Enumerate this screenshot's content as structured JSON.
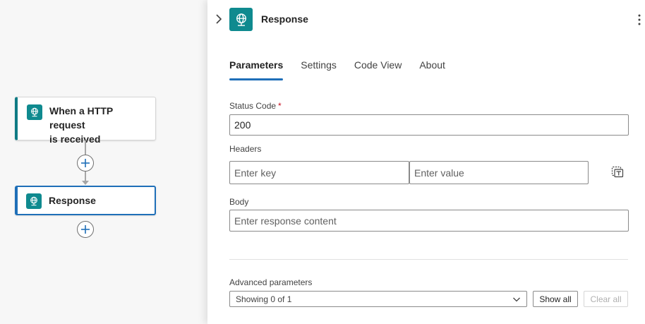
{
  "flow": {
    "trigger": {
      "label_line1": "When a HTTP request",
      "label_line2": "is received",
      "icon": "globe-network-icon"
    },
    "action": {
      "label": "Response",
      "icon": "globe-network-icon"
    }
  },
  "panel": {
    "title": "Response",
    "tabs": [
      {
        "label": "Parameters",
        "active": true
      },
      {
        "label": "Settings",
        "active": false
      },
      {
        "label": "Code View",
        "active": false
      },
      {
        "label": "About",
        "active": false
      }
    ],
    "status_code": {
      "label": "Status Code",
      "required_mark": "*",
      "value": "200"
    },
    "headers": {
      "label": "Headers",
      "key_placeholder": "Enter key",
      "value_placeholder": "Enter value"
    },
    "body": {
      "label": "Body",
      "placeholder": "Enter response content"
    },
    "advanced": {
      "label": "Advanced parameters",
      "selected": "Showing 0 of 1",
      "show_all": "Show all",
      "clear_all": "Clear all"
    }
  },
  "colors": {
    "accent": "#1f6fb8",
    "brand": "#0f8a8f",
    "required": "#c50f1f"
  }
}
